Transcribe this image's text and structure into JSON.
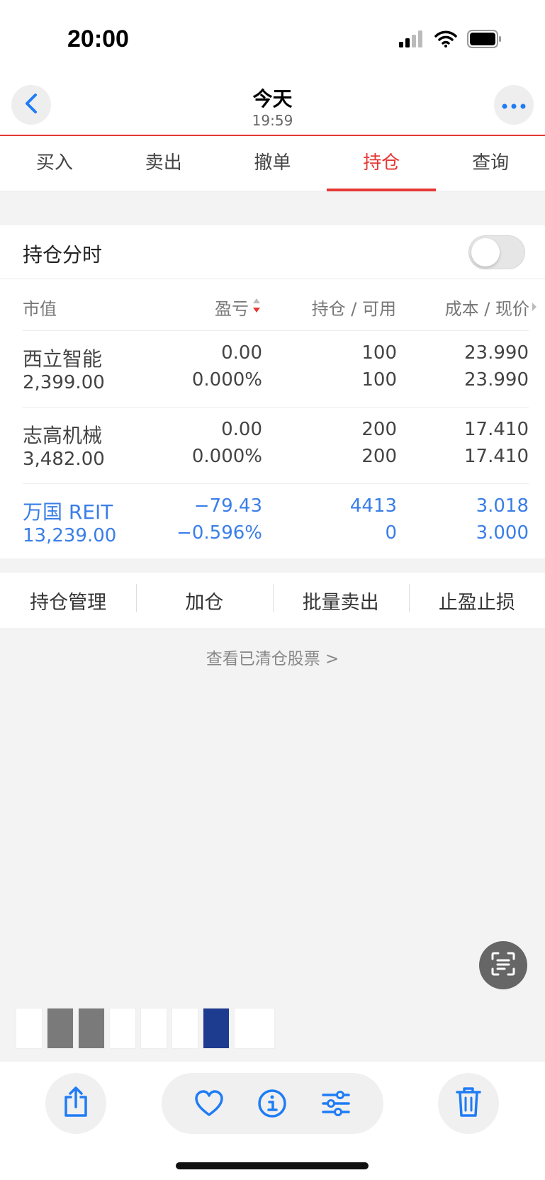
{
  "status_bar": {
    "time": "20:00",
    "icons": [
      "signal-icon",
      "wifi-icon",
      "battery-icon"
    ]
  },
  "header": {
    "title": "今天",
    "subtitle": "19:59",
    "back_icon": "chevron-left-icon",
    "more_icon": "ellipsis-icon"
  },
  "tabs": [
    {
      "label": "买入",
      "active": false
    },
    {
      "label": "卖出",
      "active": false
    },
    {
      "label": "撤单",
      "active": false
    },
    {
      "label": "持仓",
      "active": true
    },
    {
      "label": "查询",
      "active": false
    }
  ],
  "toggle_row": {
    "label": "持仓分时",
    "enabled": false
  },
  "table": {
    "headers": {
      "market_value": "市值",
      "pnl": "盈亏",
      "position": "持仓 / 可用",
      "cost": "成本 / 现价"
    },
    "rows": [
      {
        "name": "西立智能",
        "market_value": "2,399.00",
        "pnl": "0.00",
        "pnl_pct": "0.000%",
        "position": "100",
        "available": "100",
        "cost": "23.990",
        "price": "23.990",
        "highlight": false
      },
      {
        "name": "志高机械",
        "market_value": "3,482.00",
        "pnl": "0.00",
        "pnl_pct": "0.000%",
        "position": "200",
        "available": "200",
        "cost": "17.410",
        "price": "17.410",
        "highlight": false
      },
      {
        "name": "万国 REIT",
        "market_value": "13,239.00",
        "pnl": "−79.43",
        "pnl_pct": "−0.596%",
        "position": "4413",
        "available": "0",
        "cost": "3.018",
        "price": "3.000",
        "highlight": true
      }
    ]
  },
  "actions": [
    "持仓管理",
    "加仓",
    "批量卖出",
    "止盈止损"
  ],
  "cleared_link": "查看已清仓股票 >",
  "colors": {
    "accent_red": "#e53935",
    "blue": "#3a7ee8",
    "ios_blue": "#1f7cf5"
  },
  "toolbar": {
    "icons": [
      "share-icon",
      "heart-icon",
      "info-icon",
      "sliders-icon",
      "trash-icon"
    ]
  }
}
